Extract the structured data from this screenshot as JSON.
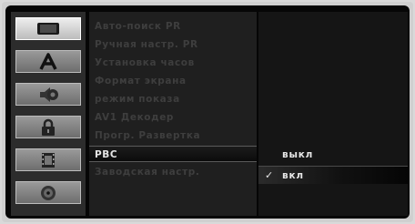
{
  "sidebar": {
    "icons": [
      {
        "name": "tv-icon",
        "selected": true
      },
      {
        "name": "language-icon"
      },
      {
        "name": "speaker-icon"
      },
      {
        "name": "lock-icon"
      },
      {
        "name": "film-icon"
      },
      {
        "name": "disc-icon"
      }
    ]
  },
  "menu": {
    "items": [
      {
        "label": "Авто-поиск PR"
      },
      {
        "label": "Ручная настр. PR"
      },
      {
        "label": "Установка часов"
      },
      {
        "label": "Формат экрана"
      },
      {
        "label": "режим показа"
      },
      {
        "label": "AV1 Декодер"
      },
      {
        "label": "Прогр. Развертка"
      },
      {
        "label": "PBC",
        "active": true
      },
      {
        "label": "Заводская настр."
      }
    ]
  },
  "options": {
    "items": [
      {
        "label": "выкл",
        "selected": false
      },
      {
        "label": "вкл",
        "selected": true,
        "check": "✓"
      }
    ]
  }
}
